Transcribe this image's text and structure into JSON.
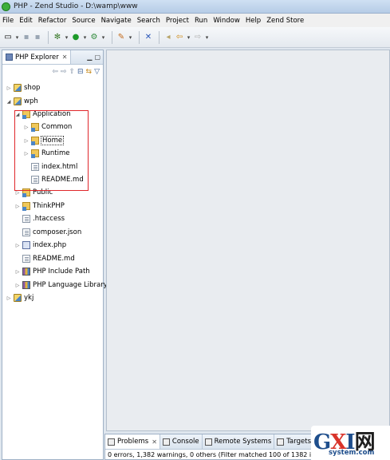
{
  "window": {
    "title": "PHP - Zend Studio - D:\\wamp\\www"
  },
  "menu": [
    "File",
    "Edit",
    "Refactor",
    "Source",
    "Navigate",
    "Search",
    "Project",
    "Run",
    "Window",
    "Help",
    "Zend Store"
  ],
  "explorer": {
    "tab_label": "PHP Explorer",
    "tree": [
      {
        "label": "shop",
        "icon": "project-icon",
        "twisty": "collapsed"
      },
      {
        "label": "wph",
        "icon": "project-icon",
        "twisty": "expanded"
      },
      {
        "label": "Application",
        "icon": "package-folder-icon",
        "twisty": "expanded"
      },
      {
        "label": "Common",
        "icon": "package-folder-icon",
        "twisty": "collapsed"
      },
      {
        "label": "Home",
        "icon": "package-folder-icon",
        "twisty": "collapsed",
        "selected": true
      },
      {
        "label": "Runtime",
        "icon": "package-folder-icon",
        "twisty": "collapsed"
      },
      {
        "label": "index.html",
        "icon": "file-icon",
        "twisty": "none"
      },
      {
        "label": "README.md",
        "icon": "file-icon",
        "twisty": "none"
      },
      {
        "label": "Public",
        "icon": "package-folder-icon",
        "twisty": "collapsed"
      },
      {
        "label": "ThinkPHP",
        "icon": "package-folder-icon",
        "twisty": "collapsed"
      },
      {
        "label": ".htaccess",
        "icon": "file-icon",
        "twisty": "none"
      },
      {
        "label": "composer.json",
        "icon": "file-icon",
        "twisty": "none"
      },
      {
        "label": "index.php",
        "icon": "php-file-icon",
        "twisty": "collapsed"
      },
      {
        "label": "README.md",
        "icon": "file-icon",
        "twisty": "none"
      },
      {
        "label": "PHP Include Path",
        "icon": "library-icon",
        "twisty": "collapsed"
      },
      {
        "label": "PHP Language Library",
        "icon": "library-icon",
        "twisty": "collapsed"
      },
      {
        "label": "ykj",
        "icon": "project-icon",
        "twisty": "collapsed"
      }
    ]
  },
  "bottom_panel": {
    "tabs": [
      "Problems",
      "Console",
      "Remote Systems",
      "Targets"
    ],
    "status": "0 errors, 1,382 warnings, 0 others (Filter matched 100 of 1382 items)"
  },
  "watermark": {
    "brand_g": "G",
    "brand_x": "X",
    "brand_i": "I",
    "brand_wang": "网",
    "site": "system.com"
  },
  "colors": {
    "highlight_box": "#e0272b",
    "titlebar": "#cfe0f3",
    "editor_bg": "#e9ecf0"
  }
}
